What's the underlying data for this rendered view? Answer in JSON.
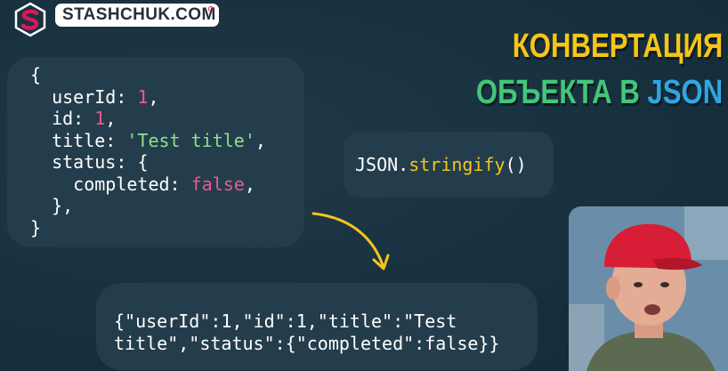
{
  "brand": {
    "name": "STASHCHUK.COM",
    "logo_icon": "stashchuk-s-logo-icon",
    "colors": {
      "logo": "#d6195b",
      "pill": "#ffffff",
      "text": "#23313a"
    }
  },
  "headline": {
    "line1": "КОНВЕРТАЦИЯ",
    "line2_word": "ОБЪЕКТА В",
    "line2_accent": "JSON",
    "colors": {
      "line1": "#f5c51a",
      "line2": "#43c67a",
      "accent": "#2fa6e0"
    }
  },
  "object_code": {
    "open_brace": "{",
    "userId_key": "userId:",
    "userId_value": "1",
    "id_key": "id:",
    "id_value": "1",
    "title_key": "title:",
    "title_value": "'Test title'",
    "status_key": "status:",
    "status_open": "{",
    "completed_key": "completed:",
    "completed_value": "false",
    "status_close": "},",
    "close_brace": "}"
  },
  "method_call": {
    "object": "JSON.",
    "method": "stringify",
    "parens": "()"
  },
  "json_output": {
    "line1": "{\"userId\":1,\"id\":1,\"title\":\"Test",
    "line2": "title\",\"status\":{\"completed\":false}}"
  },
  "arrow_icon": "curved-arrow-down-right-icon",
  "presenter_image": "presenter-photo"
}
